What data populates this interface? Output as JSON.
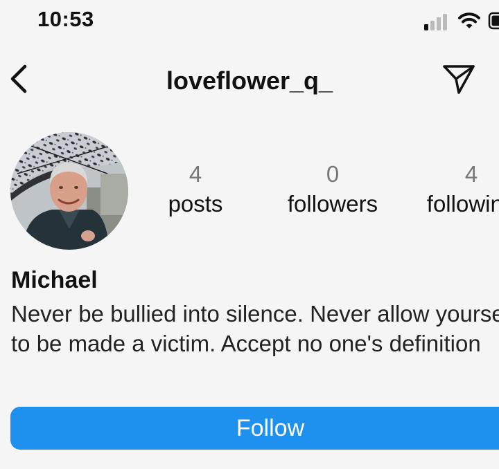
{
  "status_bar": {
    "time": "10:53",
    "icons": [
      "cellular-signal-icon",
      "wifi-icon",
      "battery-icon"
    ]
  },
  "header": {
    "username": "loveflower_q_",
    "back_icon": "chevron-left-icon",
    "share_icon": "paper-plane-icon"
  },
  "profile": {
    "avatar_icon": "avatar-photo",
    "stats": {
      "posts": {
        "count": "4",
        "label": "posts"
      },
      "followers": {
        "count": "0",
        "label": "followers"
      },
      "following": {
        "count": "4",
        "label": "following"
      }
    },
    "name": "Michael",
    "bio": "Never be bullied into silence. Never allow yourself to be made a victim. Accept no one's definition"
  },
  "actions": {
    "follow_label": "Follow"
  },
  "colors": {
    "background": "#f5f5f5",
    "accent": "#1e90ee",
    "muted_text": "#777777"
  }
}
